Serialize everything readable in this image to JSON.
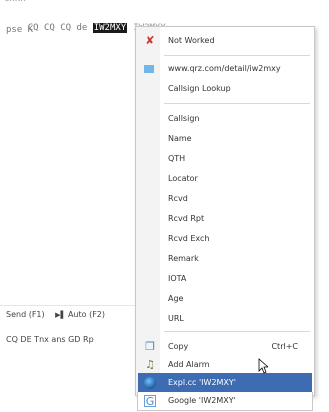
{
  "editor": {
    "top_cut": "cxxx",
    "line1_prefix": "CQ CQ CQ de ",
    "line1_highlight": "IW2MXY",
    "line1_suffix": "IW2MXY",
    "line2": "pse K"
  },
  "toolbar": {
    "send": "Send (F1)",
    "auto": "Auto (F2)",
    "macros": "CQ DE Tnx ans GD Rp"
  },
  "menu": {
    "not_worked": "Not Worked",
    "qrz_url": "www.qrz.com/detail/iw2mxy",
    "callsign_lookup": "Callsign Lookup",
    "fields": [
      "Callsign",
      "Name",
      "QTH",
      "Locator",
      "Rcvd",
      "Rcvd Rpt",
      "Rcvd Exch",
      "Remark",
      "IOTA",
      "Age",
      "URL"
    ],
    "copy": "Copy",
    "copy_shortcut": "Ctrl+C",
    "add_alarm": "Add Alarm",
    "expl": "Expl.cc 'IW2MXY'",
    "google": "Google 'IW2MXY'"
  },
  "colors": {
    "highlight": "#3d6cb3",
    "selection_bg": "#1a1a1a"
  }
}
